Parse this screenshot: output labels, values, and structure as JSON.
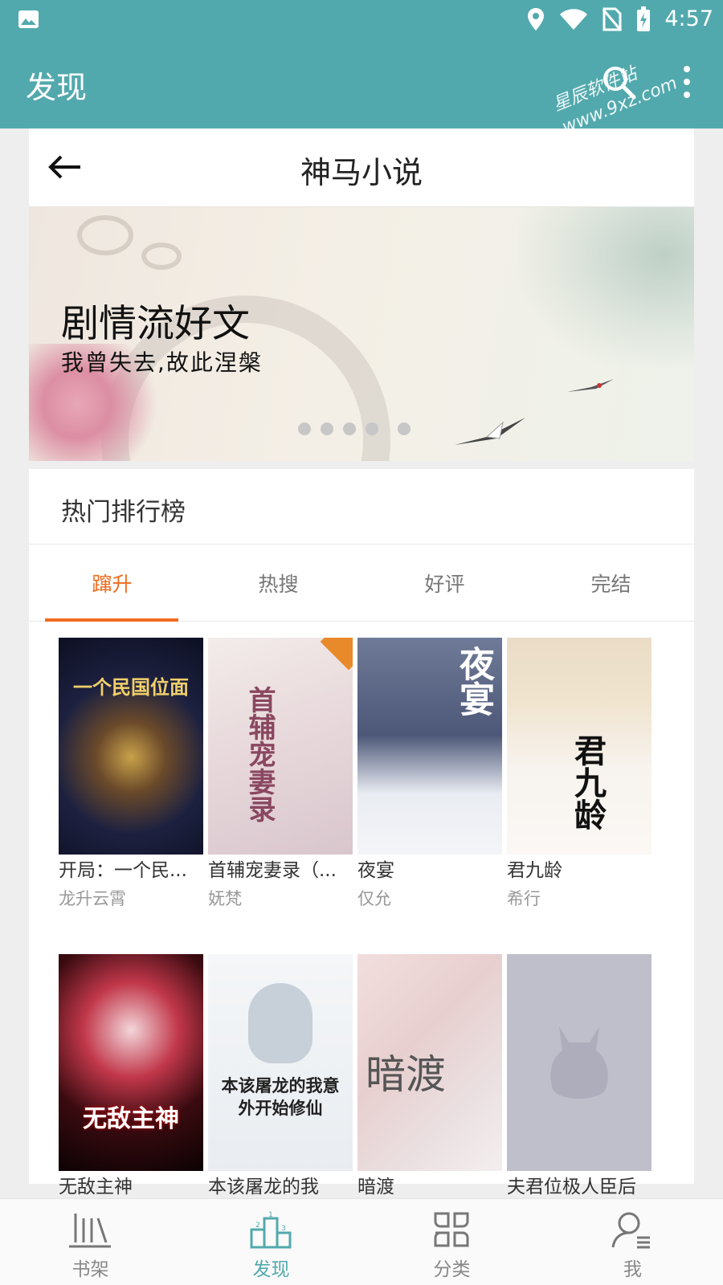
{
  "status_bar": {
    "time": "4:57"
  },
  "app_bar": {
    "title": "发现",
    "watermark_line1": "星辰软件站",
    "watermark_line2": "www.9xz.com"
  },
  "subheader": {
    "title": "神马小说"
  },
  "banner": {
    "title": "剧情流好文",
    "subtitle": "我曾失去,故此涅槃",
    "page_count": 5,
    "active_page": 4
  },
  "section": {
    "title": "热门排行榜"
  },
  "tabs": [
    {
      "label": "蹿升",
      "active": true
    },
    {
      "label": "热搜",
      "active": false
    },
    {
      "label": "好评",
      "active": false
    },
    {
      "label": "完结",
      "active": false
    }
  ],
  "books": [
    {
      "title": "开局：一个民...",
      "author": "龙升云霄",
      "cover_text": "一个民国位面"
    },
    {
      "title": "首辅宠妻录（...",
      "author": "妩梵",
      "cover_text": "首辅宠妻录"
    },
    {
      "title": "夜宴",
      "author": "仅允",
      "cover_text": "夜宴"
    },
    {
      "title": "君九龄",
      "author": "希行",
      "cover_text": "君九龄"
    },
    {
      "title": "无敌主神",
      "author": "",
      "cover_text": "无敌主神"
    },
    {
      "title": "本该屠龙的我",
      "author": "",
      "cover_text": "本该屠龙的我意外开始修仙"
    },
    {
      "title": "暗渡",
      "author": "",
      "cover_text": "暗渡"
    },
    {
      "title": "夫君位极人臣后",
      "author": "",
      "cover_text": ""
    }
  ],
  "bottom_nav": [
    {
      "label": "书架",
      "icon": "bookshelf-icon",
      "active": false
    },
    {
      "label": "发现",
      "icon": "podium-icon",
      "active": true
    },
    {
      "label": "分类",
      "icon": "category-icon",
      "active": false
    },
    {
      "label": "我",
      "icon": "profile-icon",
      "active": false
    }
  ],
  "colors": {
    "primary": "#52a9ad",
    "accent": "#ef6c20"
  }
}
